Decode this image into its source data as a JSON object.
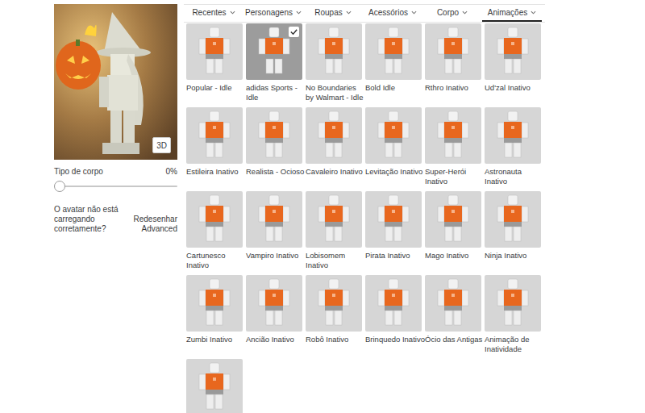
{
  "preview": {
    "button": "3D"
  },
  "body_type": {
    "label": "Tipo de corpo",
    "reading": "0%",
    "level": 0
  },
  "help": {
    "question": "O avatar não está carregando corretamente?",
    "links": [
      "Redesenhar",
      "Advanced"
    ]
  },
  "tabs": [
    {
      "label": "Recentes",
      "selected": false
    },
    {
      "label": "Personagens",
      "selected": false
    },
    {
      "label": "Roupas",
      "selected": false
    },
    {
      "label": "Acessórios",
      "selected": false
    },
    {
      "label": "Corpo",
      "selected": false
    },
    {
      "label": "Animações",
      "selected": true
    }
  ],
  "items": [
    {
      "name": "Popular - Idle",
      "selected": false
    },
    {
      "name": "adidas Sports - Idle",
      "selected": true
    },
    {
      "name": "No Boundaries by Walmart - Idle",
      "selected": false
    },
    {
      "name": "Bold Idle",
      "selected": false
    },
    {
      "name": "Rthro Inativo",
      "selected": false
    },
    {
      "name": "Ud'zal Inativo",
      "selected": false
    },
    {
      "name": "Estileira Inativo",
      "selected": false
    },
    {
      "name": "Realista - Ocioso",
      "selected": false
    },
    {
      "name": "Cavaleiro Inativo",
      "selected": false
    },
    {
      "name": "Levitação Inativo",
      "selected": false
    },
    {
      "name": "Super-Herói Inativo",
      "selected": false
    },
    {
      "name": "Astronauta Inativo",
      "selected": false
    },
    {
      "name": "Cartunesco Inativo",
      "selected": false
    },
    {
      "name": "Vampiro Inativo",
      "selected": false
    },
    {
      "name": "Lobisomem Inativo",
      "selected": false
    },
    {
      "name": "Pirata Inativo",
      "selected": false
    },
    {
      "name": "Mago Inativo",
      "selected": false
    },
    {
      "name": "Ninja Inativo",
      "selected": false
    },
    {
      "name": "Zumbi Inativo",
      "selected": false
    },
    {
      "name": "Ancião Inativo",
      "selected": false
    },
    {
      "name": "Robô Inativo",
      "selected": false
    },
    {
      "name": "Brinquedo Inativo",
      "selected": false
    },
    {
      "name": "Ócio das Antigas",
      "selected": false
    },
    {
      "name": "Animação de Inatividade",
      "selected": false
    },
    {
      "selected": false
    }
  ]
}
